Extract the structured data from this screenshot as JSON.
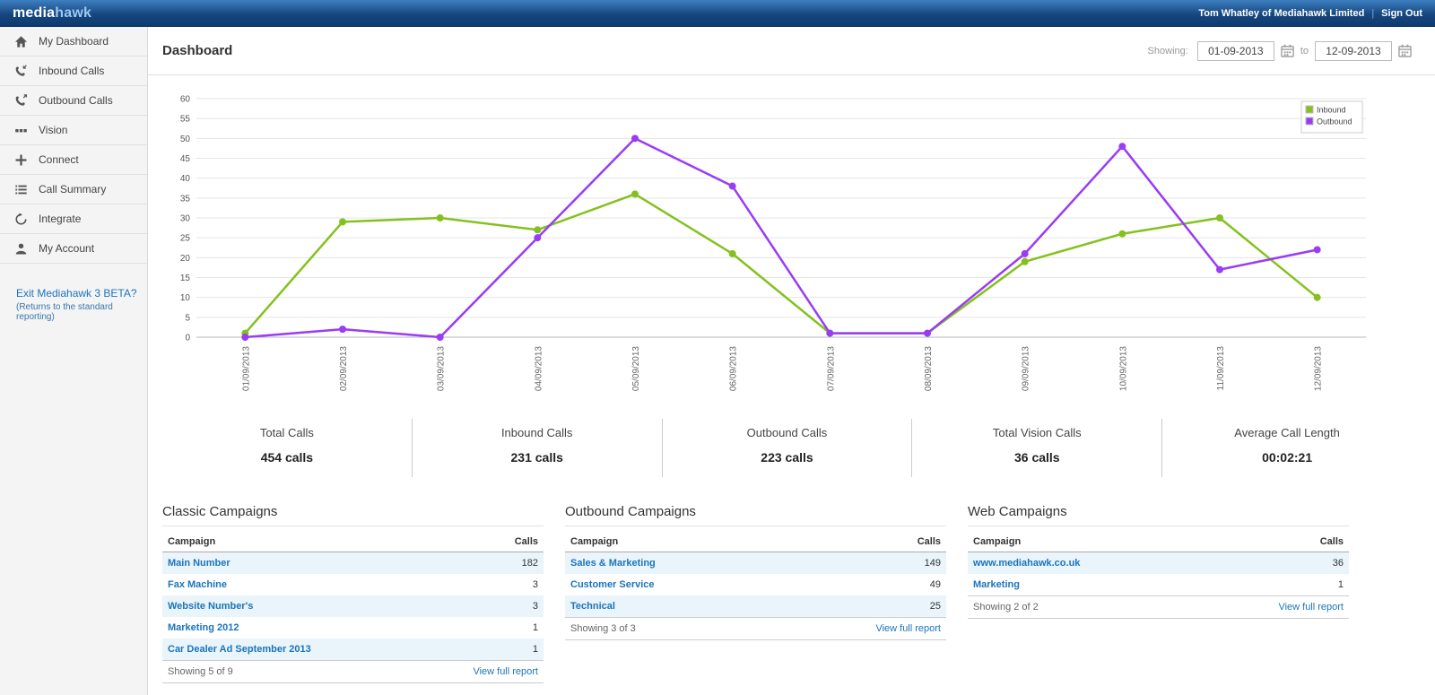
{
  "topbar": {
    "logo_media": "media",
    "logo_hawk": "hawk",
    "user": "Tom Whatley of Mediahawk Limited",
    "separator": "|",
    "sign_out": "Sign Out"
  },
  "sidebar": {
    "items": [
      {
        "label": "My Dashboard",
        "icon": "home"
      },
      {
        "label": "Inbound Calls",
        "icon": "phone-inbound"
      },
      {
        "label": "Outbound Calls",
        "icon": "phone-outbound"
      },
      {
        "label": "Vision",
        "icon": "vision"
      },
      {
        "label": "Connect",
        "icon": "connect"
      },
      {
        "label": "Call Summary",
        "icon": "list"
      },
      {
        "label": "Integrate",
        "icon": "refresh"
      },
      {
        "label": "My Account",
        "icon": "person"
      }
    ],
    "exit_link": "Exit Mediahawk 3 BETA?",
    "exit_note": "(Returns to the standard reporting)"
  },
  "header": {
    "title": "Dashboard",
    "showing_label": "Showing:",
    "date_from": "01-09-2013",
    "to_label": "to",
    "date_to": "12-09-2013"
  },
  "chart_data": {
    "type": "line",
    "x": [
      "01/09/2013",
      "02/09/2013",
      "03/09/2013",
      "04/09/2013",
      "05/09/2013",
      "06/09/2013",
      "07/09/2013",
      "08/09/2013",
      "09/09/2013",
      "10/09/2013",
      "11/09/2013",
      "12/09/2013"
    ],
    "series": [
      {
        "name": "Inbound",
        "color": "#84c11e",
        "values": [
          1,
          29,
          30,
          27,
          36,
          21,
          1,
          1,
          19,
          26,
          30,
          10
        ]
      },
      {
        "name": "Outbound",
        "color": "#9a3bf5",
        "values": [
          0,
          2,
          0,
          25,
          50,
          38,
          1,
          1,
          21,
          48,
          17,
          22
        ]
      }
    ],
    "ylim": [
      0,
      60
    ],
    "ytick_step": 5,
    "grid": true,
    "legend_position": "top-right"
  },
  "stats": [
    {
      "label": "Total Calls",
      "value": "454 calls"
    },
    {
      "label": "Inbound Calls",
      "value": "231 calls"
    },
    {
      "label": "Outbound Calls",
      "value": "223 calls"
    },
    {
      "label": "Total Vision Calls",
      "value": "36 calls"
    },
    {
      "label": "Average Call Length",
      "value": "00:02:21"
    }
  ],
  "tables": [
    {
      "title": "Classic Campaigns",
      "col_campaign": "Campaign",
      "col_calls": "Calls",
      "rows": [
        {
          "name": "Main Number",
          "calls": "182"
        },
        {
          "name": "Fax Machine",
          "calls": "3"
        },
        {
          "name": "Website Number's",
          "calls": "3"
        },
        {
          "name": "Marketing 2012",
          "calls": "1"
        },
        {
          "name": "Car Dealer Ad September 2013",
          "calls": "1"
        }
      ],
      "showing": "Showing 5 of 9",
      "view_report": "View full report"
    },
    {
      "title": "Outbound Campaigns",
      "col_campaign": "Campaign",
      "col_calls": "Calls",
      "rows": [
        {
          "name": "Sales & Marketing",
          "calls": "149"
        },
        {
          "name": "Customer Service",
          "calls": "49"
        },
        {
          "name": "Technical",
          "calls": "25"
        }
      ],
      "showing": "Showing 3 of 3",
      "view_report": "View full report"
    },
    {
      "title": "Web Campaigns",
      "col_campaign": "Campaign",
      "col_calls": "Calls",
      "rows": [
        {
          "name": "www.mediahawk.co.uk",
          "calls": "36"
        },
        {
          "name": "Marketing",
          "calls": "1"
        }
      ],
      "showing": "Showing 2 of 2",
      "view_report": "View full report"
    }
  ]
}
